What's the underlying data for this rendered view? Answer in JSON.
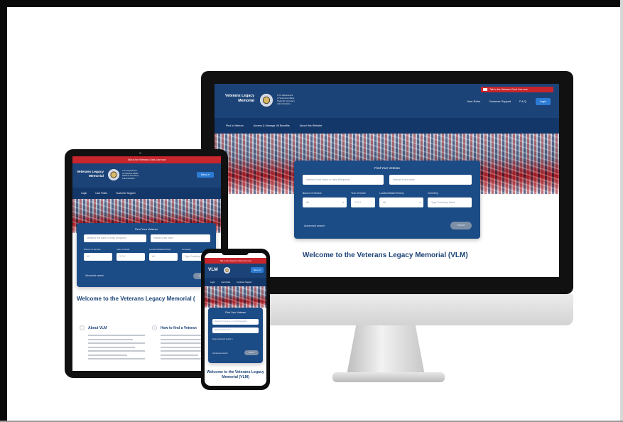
{
  "site": {
    "logo_line1": "Veterans Legacy",
    "logo_line2": "Memorial",
    "logo_short": "VLM",
    "dept_line1": "U.S. Department",
    "dept_line2": "of Veterans Affairs",
    "dept_line3": "National Cemetery",
    "dept_line4": "Administration"
  },
  "alert": {
    "text": "Talk to the Veterans Crisis Line now"
  },
  "header": {
    "links": [
      "User Roles",
      "Customer Support",
      "F.A.Q.",
      "Login"
    ],
    "menu_label": "Menu"
  },
  "nav": {
    "desktop": [
      "Find a Veteran",
      "Access & Manage VA Benefits",
      "About this Website"
    ],
    "tablet": [
      "Login",
      "User Roles",
      "Customer Support"
    ],
    "phone": [
      "Login",
      "User Roles",
      "Customer Support"
    ]
  },
  "finder": {
    "title": "Find Your Veteran",
    "first_name_placeholder": "Veteran's first name or initial (Required)",
    "last_name_placeholder": "Veteran's last name",
    "labels": [
      "Branch of Service",
      "Year of Death",
      "Location/State/Territory",
      "Cemetery"
    ],
    "branch_value": "All",
    "year_placeholder": "YYYY",
    "location_value": "All",
    "cemetery_placeholder": "Type Cemetery Name",
    "advanced_label": "Advanced search",
    "search_label": "Search",
    "more_options": "Enter advanced search +"
  },
  "main": {
    "welcome": "Welcome to the Veterans Legacy Memorial (VLM)",
    "tablet_welcome": "Welcome to the Veterans Legacy Memorial (",
    "phone_welcome": "Welcome to the Veterans Legacy Memorial (VLM)",
    "about_title": "About VLM",
    "howto_title": "How to find a Veteran"
  },
  "colors": {
    "header": "#1c4377",
    "nav": "#143769",
    "alert": "#c8252c",
    "accent": "#2c7bd4"
  }
}
